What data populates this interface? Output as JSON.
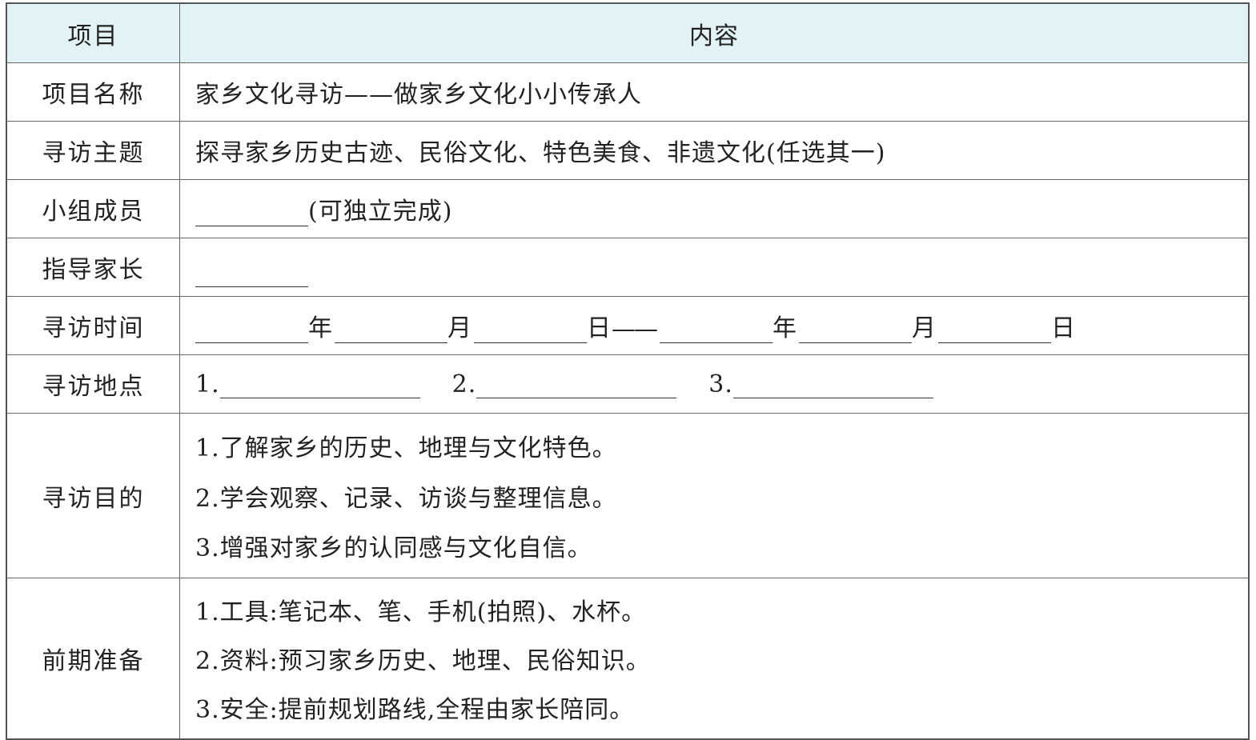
{
  "header": {
    "col1": "项目",
    "col2": "内容"
  },
  "rows": {
    "name": {
      "label": "项目名称",
      "value": "家乡文化寻访——做家乡文化小小传承人"
    },
    "theme": {
      "label": "寻访主题",
      "value": "探寻家乡历史古迹、民俗文化、特色美食、非遗文化(任选其一)"
    },
    "members": {
      "label": "小组成员",
      "note": "(可独立完成)"
    },
    "guide": {
      "label": "指导家长"
    },
    "time": {
      "label": "寻访时间",
      "year": "年",
      "month": "月",
      "day": "日",
      "dash": "——"
    },
    "place": {
      "label": "寻访地点",
      "n1": "1.",
      "n2": "2.",
      "n3": "3."
    },
    "purpose": {
      "label": "寻访目的",
      "items": [
        "1.了解家乡的历史、地理与文化特色。",
        "2.学会观察、记录、访谈与整理信息。",
        "3.增强对家乡的认同感与文化自信。"
      ]
    },
    "prep": {
      "label": "前期准备",
      "items": [
        "1.工具:笔记本、笔、手机(拍照)、水杯。",
        "2.资料:预习家乡历史、地理、民俗知识。",
        "3.安全:提前规划路线,全程由家长陪同。"
      ]
    }
  }
}
